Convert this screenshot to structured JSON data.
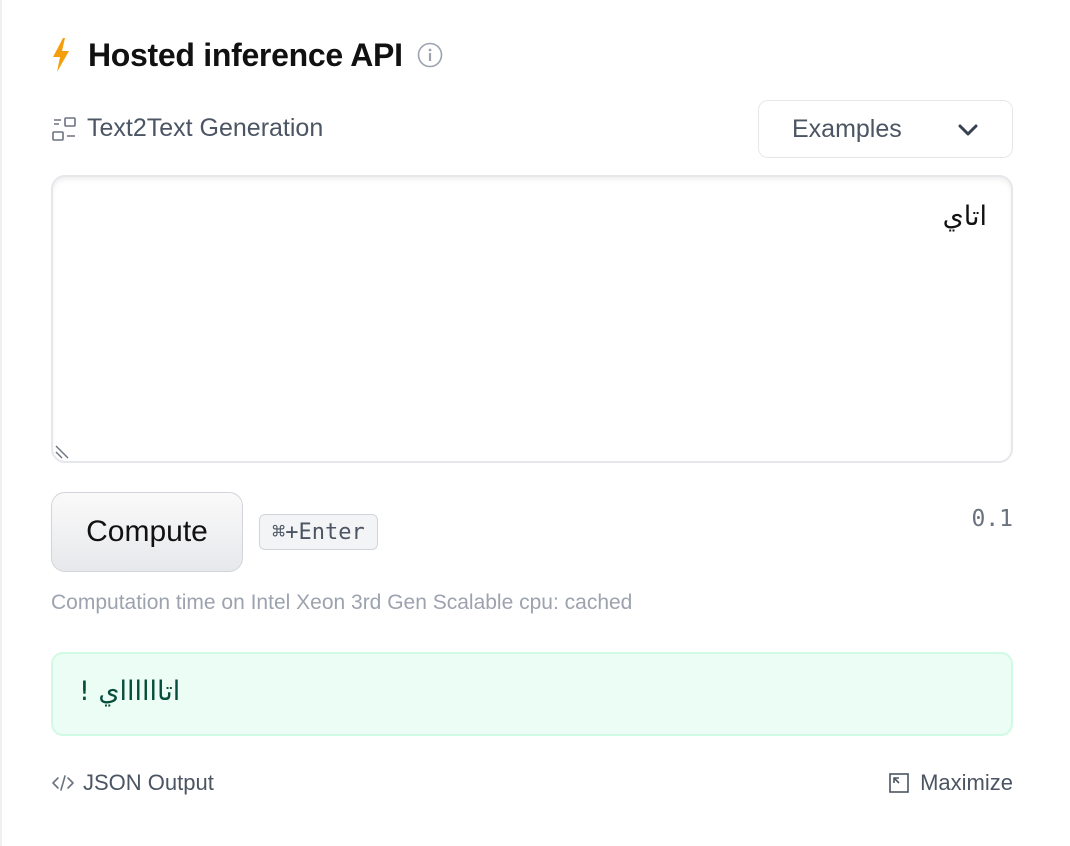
{
  "header": {
    "title": "Hosted inference API",
    "icon": "lightning-icon",
    "info_icon": "info-icon",
    "accent": "#f59e0b"
  },
  "task": {
    "label": "Text2Text Generation",
    "icon": "text2text-icon"
  },
  "examples": {
    "label": "Examples",
    "icon": "chevron-down-icon"
  },
  "input": {
    "value": "اتاي"
  },
  "compute": {
    "label": "Compute",
    "shortcut": "⌘+Enter",
    "version": "0.1"
  },
  "status": {
    "computation_time": "Computation time on Intel Xeon 3rd Gen Scalable cpu: cached"
  },
  "output": {
    "text": "اتااااااي !",
    "bg_color": "#ecfdf5"
  },
  "footer": {
    "json_label": "JSON Output",
    "maximize_label": "Maximize"
  }
}
